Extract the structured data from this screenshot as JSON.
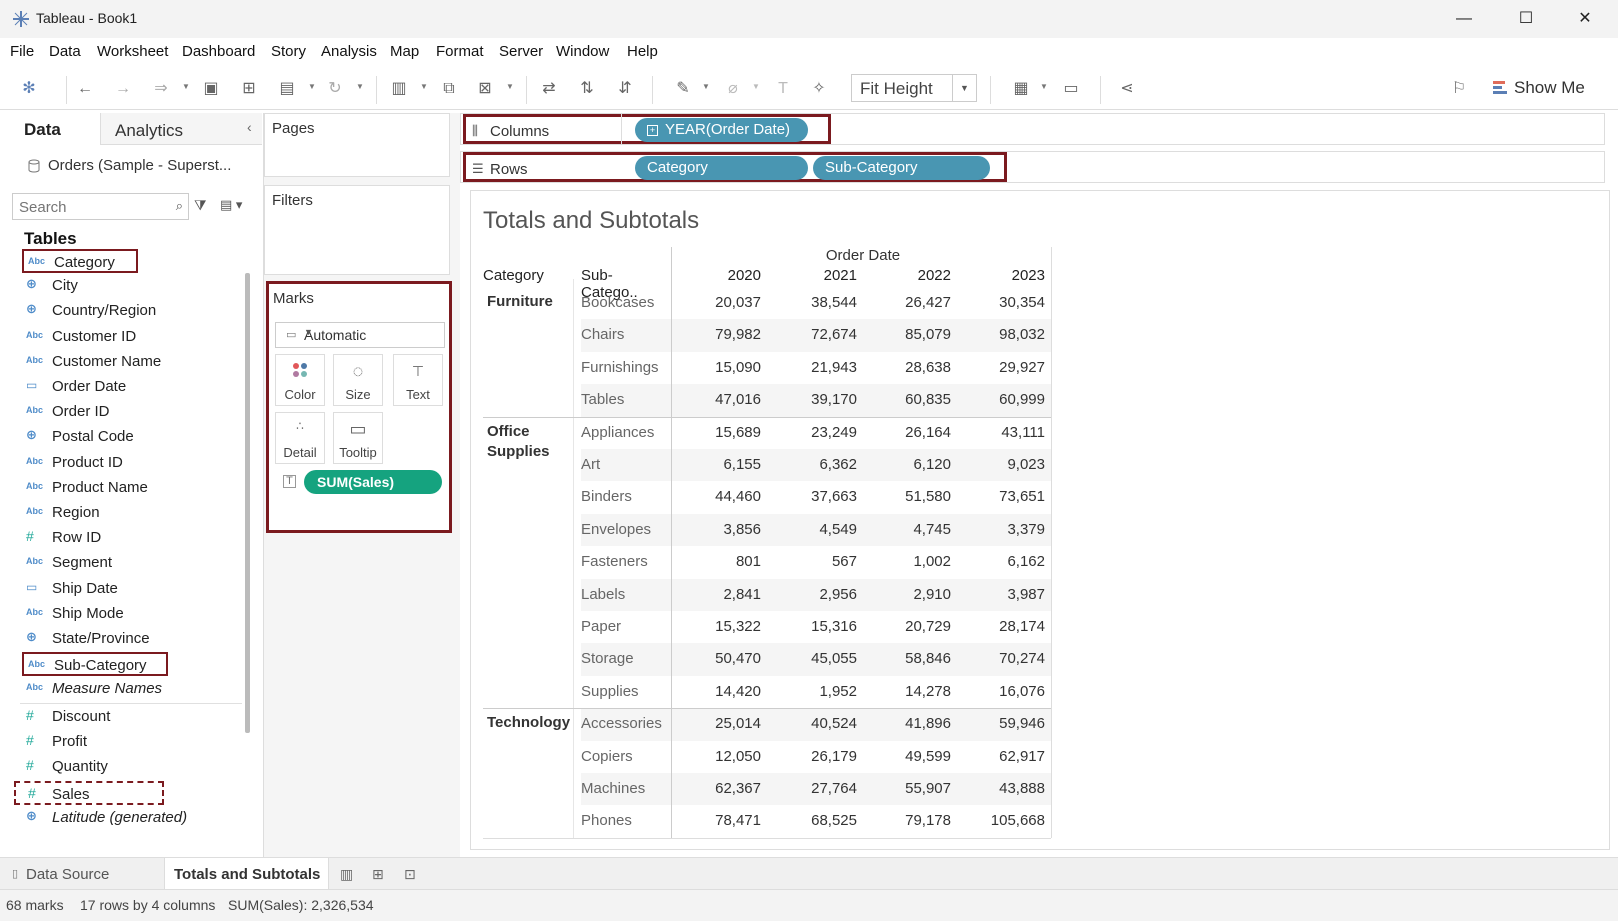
{
  "window": {
    "title": "Tableau - Book1"
  },
  "menu": [
    "File",
    "Data",
    "Worksheet",
    "Dashboard",
    "Story",
    "Analysis",
    "Map",
    "Format",
    "Server",
    "Window",
    "Help"
  ],
  "toolbar": {
    "fit": "Fit Height",
    "show_me": "Show Me"
  },
  "data_pane": {
    "tab_data": "Data",
    "tab_analytics": "Analytics",
    "datasource": "Orders (Sample - Superst...",
    "search_placeholder": "Search",
    "tables_heading": "Tables",
    "dimensions": [
      {
        "label": "Category",
        "icon": "Abc"
      },
      {
        "label": "City",
        "icon": "geo"
      },
      {
        "label": "Country/Region",
        "icon": "geo"
      },
      {
        "label": "Customer ID",
        "icon": "Abc"
      },
      {
        "label": "Customer Name",
        "icon": "Abc"
      },
      {
        "label": "Order Date",
        "icon": "date"
      },
      {
        "label": "Order ID",
        "icon": "Abc"
      },
      {
        "label": "Postal Code",
        "icon": "geo"
      },
      {
        "label": "Product ID",
        "icon": "Abc"
      },
      {
        "label": "Product Name",
        "icon": "Abc"
      },
      {
        "label": "Region",
        "icon": "Abc"
      },
      {
        "label": "Row ID",
        "icon": "#"
      },
      {
        "label": "Segment",
        "icon": "Abc"
      },
      {
        "label": "Ship Date",
        "icon": "date"
      },
      {
        "label": "Ship Mode",
        "icon": "Abc"
      },
      {
        "label": "State/Province",
        "icon": "geo"
      },
      {
        "label": "Sub-Category",
        "icon": "Abc"
      },
      {
        "label": "Measure Names",
        "icon": "Abc"
      }
    ],
    "measures": [
      {
        "label": "Discount",
        "icon": "#"
      },
      {
        "label": "Profit",
        "icon": "#"
      },
      {
        "label": "Quantity",
        "icon": "#"
      },
      {
        "label": "Sales",
        "icon": "#"
      },
      {
        "label": "Latitude (generated)",
        "icon": "geo"
      }
    ]
  },
  "cards": {
    "pages": "Pages",
    "filters": "Filters",
    "marks": "Marks",
    "mark_type": "Automatic",
    "mark_buttons": [
      "Color",
      "Size",
      "Text",
      "Detail",
      "Tooltip"
    ],
    "measure_pill": "SUM(Sales)"
  },
  "shelves": {
    "columns_label": "Columns",
    "rows_label": "Rows",
    "columns_pills": [
      "YEAR(Order Date)"
    ],
    "rows_pills": [
      "Category",
      "Sub-Category"
    ]
  },
  "view": {
    "title": "Totals and Subtotals",
    "col_group": "Order Date",
    "headers": [
      "Category",
      "Sub-Catego..",
      "2020",
      "2021",
      "2022",
      "2023"
    ],
    "rows": [
      {
        "cat": "Furniture",
        "sub": "Bookcases",
        "vals": [
          "20,037",
          "38,544",
          "26,427",
          "30,354"
        ]
      },
      {
        "cat": "",
        "sub": "Chairs",
        "vals": [
          "79,982",
          "72,674",
          "85,079",
          "98,032"
        ]
      },
      {
        "cat": "",
        "sub": "Furnishings",
        "vals": [
          "15,090",
          "21,943",
          "28,638",
          "29,927"
        ]
      },
      {
        "cat": "",
        "sub": "Tables",
        "vals": [
          "47,016",
          "39,170",
          "60,835",
          "60,999"
        ]
      },
      {
        "cat": "Office\nSupplies",
        "sub": "Appliances",
        "vals": [
          "15,689",
          "23,249",
          "26,164",
          "43,111"
        ]
      },
      {
        "cat": "",
        "sub": "Art",
        "vals": [
          "6,155",
          "6,362",
          "6,120",
          "9,023"
        ]
      },
      {
        "cat": "",
        "sub": "Binders",
        "vals": [
          "44,460",
          "37,663",
          "51,580",
          "73,651"
        ]
      },
      {
        "cat": "",
        "sub": "Envelopes",
        "vals": [
          "3,856",
          "4,549",
          "4,745",
          "3,379"
        ]
      },
      {
        "cat": "",
        "sub": "Fasteners",
        "vals": [
          "801",
          "567",
          "1,002",
          "6,162"
        ]
      },
      {
        "cat": "",
        "sub": "Labels",
        "vals": [
          "2,841",
          "2,956",
          "2,910",
          "3,987"
        ]
      },
      {
        "cat": "",
        "sub": "Paper",
        "vals": [
          "15,322",
          "15,316",
          "20,729",
          "28,174"
        ]
      },
      {
        "cat": "",
        "sub": "Storage",
        "vals": [
          "50,470",
          "45,055",
          "58,846",
          "70,274"
        ]
      },
      {
        "cat": "",
        "sub": "Supplies",
        "vals": [
          "14,420",
          "1,952",
          "14,278",
          "16,076"
        ]
      },
      {
        "cat": "Technology",
        "sub": "Accessories",
        "vals": [
          "25,014",
          "40,524",
          "41,896",
          "59,946"
        ]
      },
      {
        "cat": "",
        "sub": "Copiers",
        "vals": [
          "12,050",
          "26,179",
          "49,599",
          "62,917"
        ]
      },
      {
        "cat": "",
        "sub": "Machines",
        "vals": [
          "62,367",
          "27,764",
          "55,907",
          "43,888"
        ]
      },
      {
        "cat": "",
        "sub": "Phones",
        "vals": [
          "78,471",
          "68,525",
          "79,178",
          "105,668"
        ]
      }
    ]
  },
  "bottom": {
    "datasource_tab": "Data Source",
    "sheet_tab": "Totals and Subtotals"
  },
  "status": {
    "marks": "68 marks",
    "dims": "17 rows by 4 columns",
    "sum": "SUM(Sales): 2,326,534"
  },
  "colors": {
    "highlight": "#7b1a1f",
    "dim_pill": "#4996b2",
    "measure_pill": "#15a37f"
  }
}
